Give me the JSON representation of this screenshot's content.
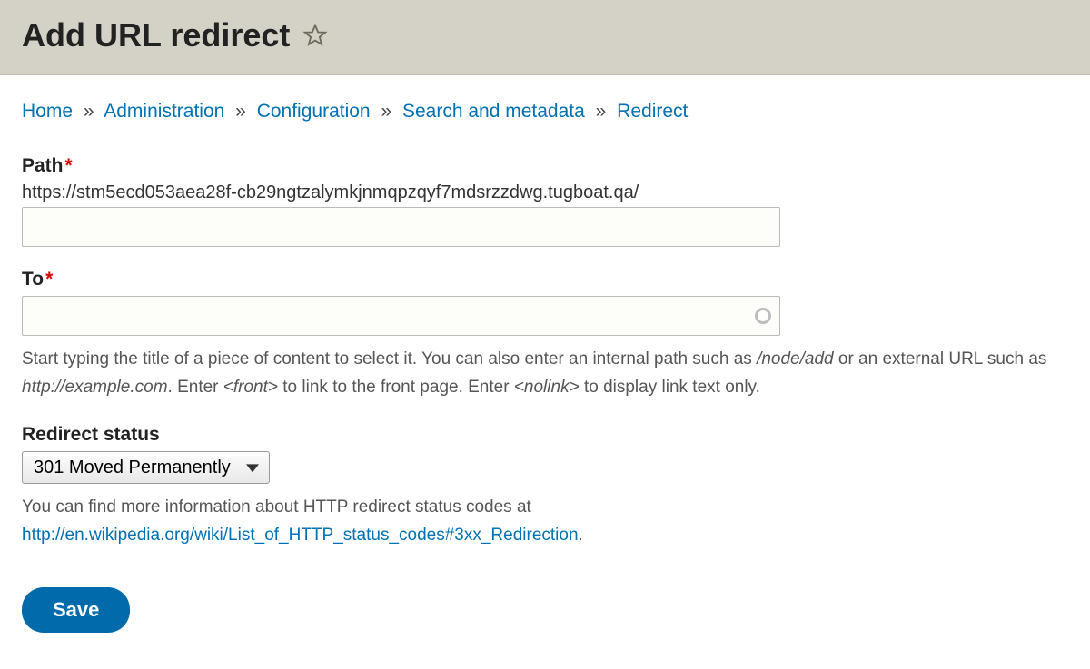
{
  "header": {
    "title": "Add URL redirect"
  },
  "breadcrumb": {
    "items": [
      {
        "label": "Home"
      },
      {
        "label": "Administration"
      },
      {
        "label": "Configuration"
      },
      {
        "label": "Search and metadata"
      },
      {
        "label": "Redirect"
      }
    ],
    "separator": "»"
  },
  "form": {
    "path": {
      "label": "Path",
      "prefix": "https://stm5ecd053aea28f-cb29ngtzalymkjnmqpzqyf7mdsrzzdwg.tugboat.qa/",
      "value": ""
    },
    "to": {
      "label": "To",
      "value": "",
      "description_parts": {
        "p1": "Start typing the title of a piece of content to select it. You can also enter an internal path such as ",
        "em1": "/node/add",
        "p2": " or an external URL such as ",
        "em2": "http://example.com",
        "p3": ". Enter ",
        "em3": "<front>",
        "p4": " to link to the front page. Enter ",
        "em4": "<nolink>",
        "p5": " to display link text only."
      }
    },
    "status": {
      "label": "Redirect status",
      "selected": "301 Moved Permanently",
      "description_text": "You can find more information about HTTP redirect status codes at ",
      "description_link": "http://en.wikipedia.org/wiki/List_of_HTTP_status_codes#3xx_Redirection",
      "description_suffix": "."
    },
    "save_label": "Save"
  }
}
